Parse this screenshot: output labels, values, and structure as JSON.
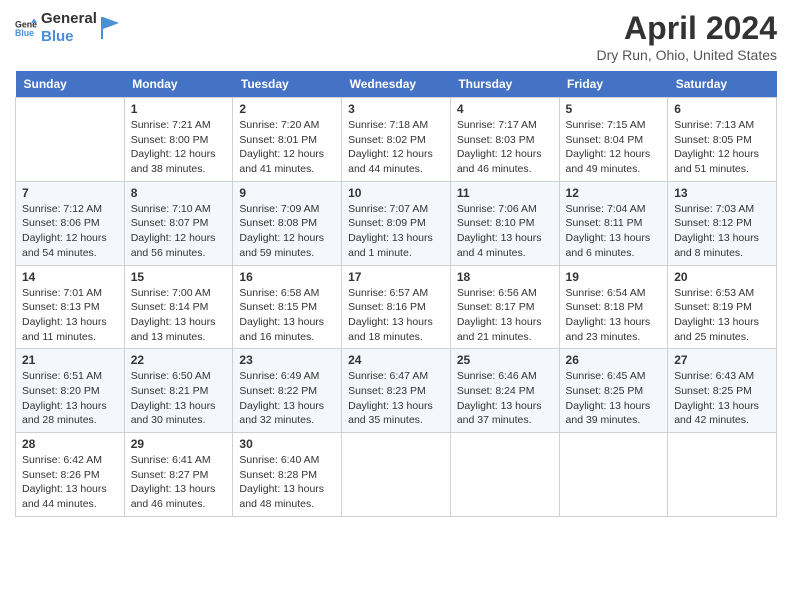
{
  "header": {
    "logo_line1": "General",
    "logo_line2": "Blue",
    "title": "April 2024",
    "subtitle": "Dry Run, Ohio, United States"
  },
  "calendar": {
    "days_of_week": [
      "Sunday",
      "Monday",
      "Tuesday",
      "Wednesday",
      "Thursday",
      "Friday",
      "Saturday"
    ],
    "weeks": [
      [
        {
          "day": "",
          "info": ""
        },
        {
          "day": "1",
          "info": "Sunrise: 7:21 AM\nSunset: 8:00 PM\nDaylight: 12 hours and 38 minutes."
        },
        {
          "day": "2",
          "info": "Sunrise: 7:20 AM\nSunset: 8:01 PM\nDaylight: 12 hours and 41 minutes."
        },
        {
          "day": "3",
          "info": "Sunrise: 7:18 AM\nSunset: 8:02 PM\nDaylight: 12 hours and 44 minutes."
        },
        {
          "day": "4",
          "info": "Sunrise: 7:17 AM\nSunset: 8:03 PM\nDaylight: 12 hours and 46 minutes."
        },
        {
          "day": "5",
          "info": "Sunrise: 7:15 AM\nSunset: 8:04 PM\nDaylight: 12 hours and 49 minutes."
        },
        {
          "day": "6",
          "info": "Sunrise: 7:13 AM\nSunset: 8:05 PM\nDaylight: 12 hours and 51 minutes."
        }
      ],
      [
        {
          "day": "7",
          "info": "Sunrise: 7:12 AM\nSunset: 8:06 PM\nDaylight: 12 hours and 54 minutes."
        },
        {
          "day": "8",
          "info": "Sunrise: 7:10 AM\nSunset: 8:07 PM\nDaylight: 12 hours and 56 minutes."
        },
        {
          "day": "9",
          "info": "Sunrise: 7:09 AM\nSunset: 8:08 PM\nDaylight: 12 hours and 59 minutes."
        },
        {
          "day": "10",
          "info": "Sunrise: 7:07 AM\nSunset: 8:09 PM\nDaylight: 13 hours and 1 minute."
        },
        {
          "day": "11",
          "info": "Sunrise: 7:06 AM\nSunset: 8:10 PM\nDaylight: 13 hours and 4 minutes."
        },
        {
          "day": "12",
          "info": "Sunrise: 7:04 AM\nSunset: 8:11 PM\nDaylight: 13 hours and 6 minutes."
        },
        {
          "day": "13",
          "info": "Sunrise: 7:03 AM\nSunset: 8:12 PM\nDaylight: 13 hours and 8 minutes."
        }
      ],
      [
        {
          "day": "14",
          "info": "Sunrise: 7:01 AM\nSunset: 8:13 PM\nDaylight: 13 hours and 11 minutes."
        },
        {
          "day": "15",
          "info": "Sunrise: 7:00 AM\nSunset: 8:14 PM\nDaylight: 13 hours and 13 minutes."
        },
        {
          "day": "16",
          "info": "Sunrise: 6:58 AM\nSunset: 8:15 PM\nDaylight: 13 hours and 16 minutes."
        },
        {
          "day": "17",
          "info": "Sunrise: 6:57 AM\nSunset: 8:16 PM\nDaylight: 13 hours and 18 minutes."
        },
        {
          "day": "18",
          "info": "Sunrise: 6:56 AM\nSunset: 8:17 PM\nDaylight: 13 hours and 21 minutes."
        },
        {
          "day": "19",
          "info": "Sunrise: 6:54 AM\nSunset: 8:18 PM\nDaylight: 13 hours and 23 minutes."
        },
        {
          "day": "20",
          "info": "Sunrise: 6:53 AM\nSunset: 8:19 PM\nDaylight: 13 hours and 25 minutes."
        }
      ],
      [
        {
          "day": "21",
          "info": "Sunrise: 6:51 AM\nSunset: 8:20 PM\nDaylight: 13 hours and 28 minutes."
        },
        {
          "day": "22",
          "info": "Sunrise: 6:50 AM\nSunset: 8:21 PM\nDaylight: 13 hours and 30 minutes."
        },
        {
          "day": "23",
          "info": "Sunrise: 6:49 AM\nSunset: 8:22 PM\nDaylight: 13 hours and 32 minutes."
        },
        {
          "day": "24",
          "info": "Sunrise: 6:47 AM\nSunset: 8:23 PM\nDaylight: 13 hours and 35 minutes."
        },
        {
          "day": "25",
          "info": "Sunrise: 6:46 AM\nSunset: 8:24 PM\nDaylight: 13 hours and 37 minutes."
        },
        {
          "day": "26",
          "info": "Sunrise: 6:45 AM\nSunset: 8:25 PM\nDaylight: 13 hours and 39 minutes."
        },
        {
          "day": "27",
          "info": "Sunrise: 6:43 AM\nSunset: 8:25 PM\nDaylight: 13 hours and 42 minutes."
        }
      ],
      [
        {
          "day": "28",
          "info": "Sunrise: 6:42 AM\nSunset: 8:26 PM\nDaylight: 13 hours and 44 minutes."
        },
        {
          "day": "29",
          "info": "Sunrise: 6:41 AM\nSunset: 8:27 PM\nDaylight: 13 hours and 46 minutes."
        },
        {
          "day": "30",
          "info": "Sunrise: 6:40 AM\nSunset: 8:28 PM\nDaylight: 13 hours and 48 minutes."
        },
        {
          "day": "",
          "info": ""
        },
        {
          "day": "",
          "info": ""
        },
        {
          "day": "",
          "info": ""
        },
        {
          "day": "",
          "info": ""
        }
      ]
    ]
  }
}
